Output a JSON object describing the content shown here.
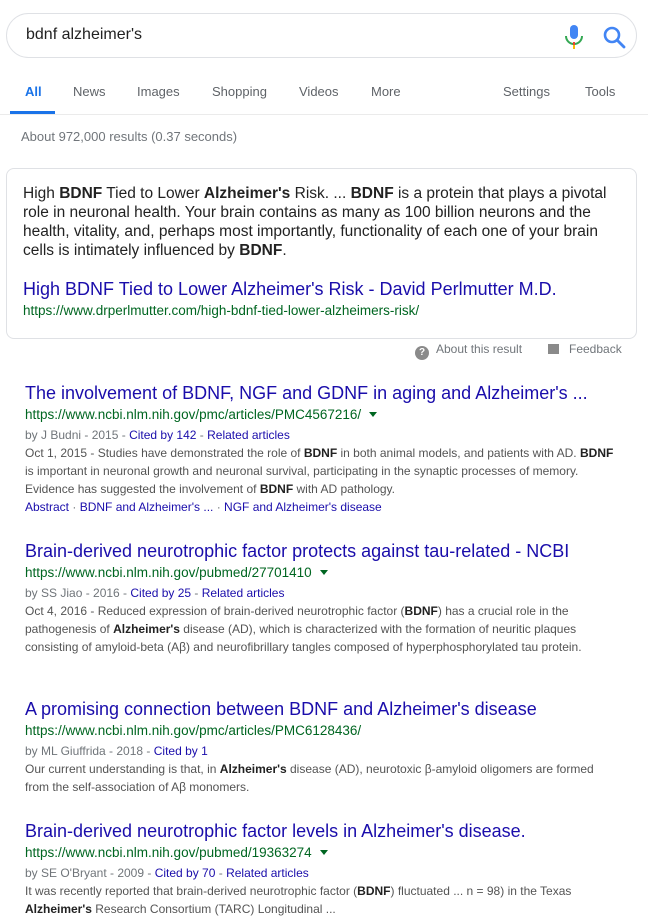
{
  "search": {
    "query": "bdnf alzheimer's"
  },
  "tabs": {
    "all": "All",
    "news": "News",
    "images": "Images",
    "shopping": "Shopping",
    "videos": "Videos",
    "more": "More",
    "settings": "Settings",
    "tools": "Tools"
  },
  "stats": "About 972,000 results (0.37 seconds)",
  "snippet": {
    "parts": [
      [
        "High ",
        false
      ],
      [
        "BDNF",
        true
      ],
      [
        " Tied to Lower ",
        false
      ],
      [
        "Alzheimer's",
        true
      ],
      [
        " Risk. ... ",
        false
      ],
      [
        "BDNF",
        true
      ],
      [
        " is a protein that plays a pivotal role in neuronal health. Your brain contains as many as 100 billion neurons and the health, vitality, and, perhaps most importantly, functionality of each one of your brain cells is intimately influenced by ",
        false
      ],
      [
        "BDNF",
        true
      ],
      [
        ".",
        false
      ]
    ],
    "title": "High BDNF Tied to Lower Alzheimer's Risk - David Perlmutter M.D.",
    "url": "https://www.drperlmutter.com/high-bdnf-tied-lower-alzheimers-risk/"
  },
  "about": {
    "label": "About this result",
    "feedback": "Feedback"
  },
  "results": [
    {
      "title": "The involvement of BDNF, NGF and GDNF in aging and Alzheimer's ...",
      "url": "https://www.ncbi.nlm.nih.gov/pmc/articles/PMC4567216/",
      "has_caret": true,
      "meta_prefix": "by J Budni - 2015 - ",
      "cited": "Cited by 142",
      "related": "Related articles",
      "desc": [
        [
          "Oct 1, 2015 - Studies have demonstrated the role of ",
          false
        ],
        [
          "BDNF",
          true
        ],
        [
          " in both animal models, and patients with AD. ",
          false
        ],
        [
          "BDNF",
          true
        ],
        [
          " is important in neuronal growth and neuronal survival, participating in the synaptic processes of memory. Evidence has suggested the involvement of ",
          false
        ],
        [
          "BDNF",
          true
        ],
        [
          " with AD pathology.",
          false
        ]
      ],
      "links": [
        "Abstract",
        "BDNF and Alzheimer's ...",
        "NGF and Alzheimer's disease"
      ]
    },
    {
      "title": "Brain-derived neurotrophic factor protects against tau-related - NCBI",
      "url": "https://www.ncbi.nlm.nih.gov/pubmed/27701410",
      "has_caret": true,
      "meta_prefix": "by SS Jiao - 2016 - ",
      "cited": "Cited by 25",
      "related": "Related articles",
      "desc": [
        [
          "Oct 4, 2016 - Reduced expression of brain-derived neurotrophic factor (",
          false
        ],
        [
          "BDNF",
          true
        ],
        [
          ") has a crucial role in the pathogenesis of ",
          false
        ],
        [
          "Alzheimer's",
          true
        ],
        [
          " disease (AD), which is characterized with the formation of neuritic plaques consisting of amyloid-beta (Aβ) and neurofibrillary tangles composed of hyperphosphorylated tau protein.",
          false
        ]
      ],
      "links": []
    },
    {
      "title": "A promising connection between BDNF and Alzheimer's disease",
      "url": "https://www.ncbi.nlm.nih.gov/pmc/articles/PMC6128436/",
      "has_caret": false,
      "meta_prefix": "by ML Giuffrida - 2018 - ",
      "cited": "Cited by 1",
      "related": "",
      "desc": [
        [
          "Our current understanding is that, in ",
          false
        ],
        [
          "Alzheimer's",
          true
        ],
        [
          " disease (AD), neurotoxic β-amyloid oligomers are formed from the self-association of Aβ monomers.",
          false
        ]
      ],
      "links": []
    },
    {
      "title": "Brain-derived neurotrophic factor levels in Alzheimer's disease.",
      "url": "https://www.ncbi.nlm.nih.gov/pubmed/19363274",
      "has_caret": true,
      "meta_prefix": "by SE O'Bryant - 2009 - ",
      "cited": "Cited by 70",
      "related": "Related articles",
      "desc": [
        [
          "It was recently reported that brain-derived neurotrophic factor (",
          false
        ],
        [
          "BDNF",
          true
        ],
        [
          ") fluctuated ... n = 98) in the Texas ",
          false
        ],
        [
          "Alzheimer's",
          true
        ],
        [
          " Research Consortium (TARC) Longitudinal ...",
          false
        ]
      ],
      "links": []
    }
  ]
}
